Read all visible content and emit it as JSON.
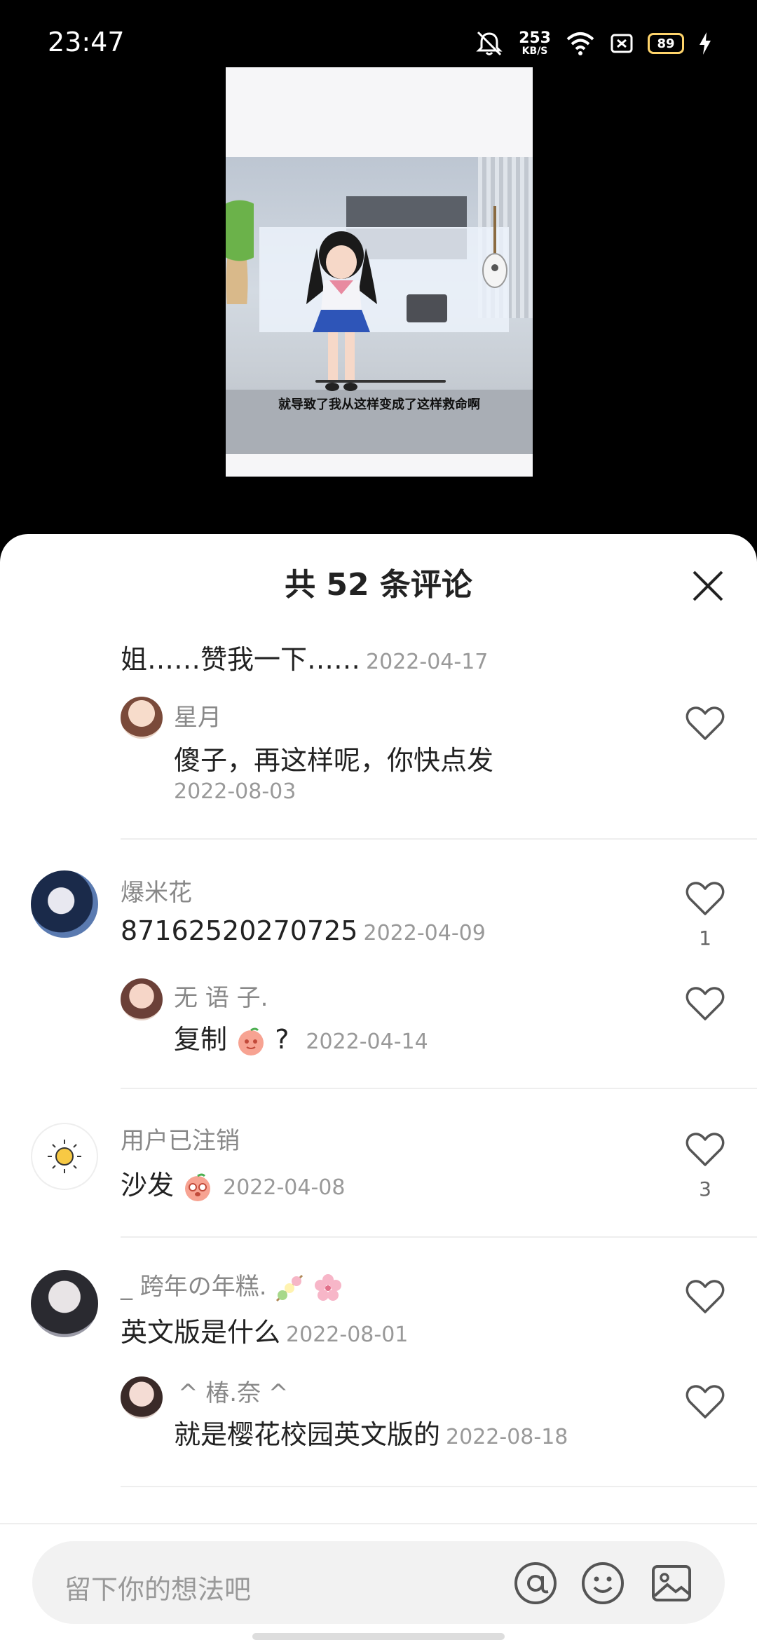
{
  "status_bar": {
    "time": "23:47",
    "net_speed": "253",
    "net_unit": "KB/S",
    "battery": "89"
  },
  "video": {
    "caption": "就导致了我从这样变成了这样救命啊"
  },
  "sheet": {
    "title": "共 52 条评论"
  },
  "comments": [
    {
      "text": "姐……赞我一下……",
      "date": "2022-04-17"
    },
    {
      "name": "星月",
      "text": "傻子，再这样呢，你快点发",
      "date": "2022-08-03"
    },
    {
      "name": "爆米花",
      "text": "87162520270725",
      "date": "2022-04-09",
      "likes": "1"
    },
    {
      "name": "无 语 子.",
      "text": "复制",
      "suffix": "?",
      "date": "2022-04-14"
    },
    {
      "name": "用户已注销",
      "text": "沙发",
      "date": "2022-04-08",
      "likes": "3"
    },
    {
      "name": "_ 跨年の年糕.",
      "text": "英文版是什么",
      "date": "2022-08-01"
    },
    {
      "name": "^ 椿.奈 ^",
      "text": "就是樱花校园英文版的",
      "date": "2022-08-18"
    }
  ],
  "input": {
    "placeholder": "留下你的想法吧"
  },
  "icons": {
    "close": "close-icon",
    "heart": "heart-icon",
    "at": "at-icon",
    "emoji": "emoji-icon",
    "image": "image-icon"
  }
}
